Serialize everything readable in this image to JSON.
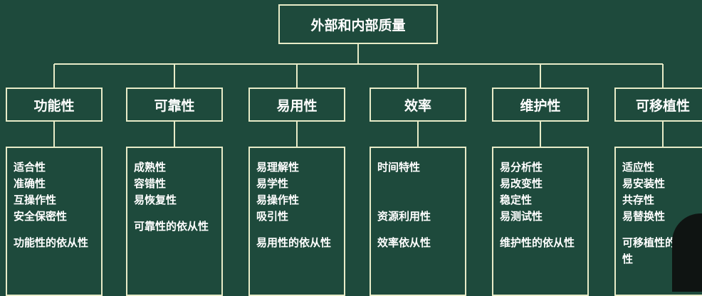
{
  "root": {
    "label": "外部和内部质量"
  },
  "categories": [
    {
      "label": "功能性",
      "items": [
        "适合性",
        "准确性",
        "互操作性",
        "安全保密性"
      ],
      "compliance": "功能性的依从性"
    },
    {
      "label": "可靠性",
      "items": [
        "成熟性",
        "容错性",
        "易恢复性"
      ],
      "compliance": "可靠性的依从性"
    },
    {
      "label": "易用性",
      "items": [
        "易理解性",
        "易学性",
        "易操作性",
        "吸引性"
      ],
      "compliance": "易用性的依从性"
    },
    {
      "label": "效率",
      "items": [
        "时间特性",
        "",
        "",
        "资源利用性"
      ],
      "compliance": "效率依从性"
    },
    {
      "label": "维护性",
      "items": [
        "易分析性",
        "易改变性",
        "稳定性",
        "易测试性"
      ],
      "compliance": "维护性的依从性"
    },
    {
      "label": "可移植性",
      "items": [
        "适应性",
        "易安装性",
        "共存性",
        "易替换性"
      ],
      "compliance": "可移植性的依从性"
    }
  ],
  "colors": {
    "background": "#1e4a3c",
    "line": "#e8ecc8",
    "text": "#ffffff"
  }
}
